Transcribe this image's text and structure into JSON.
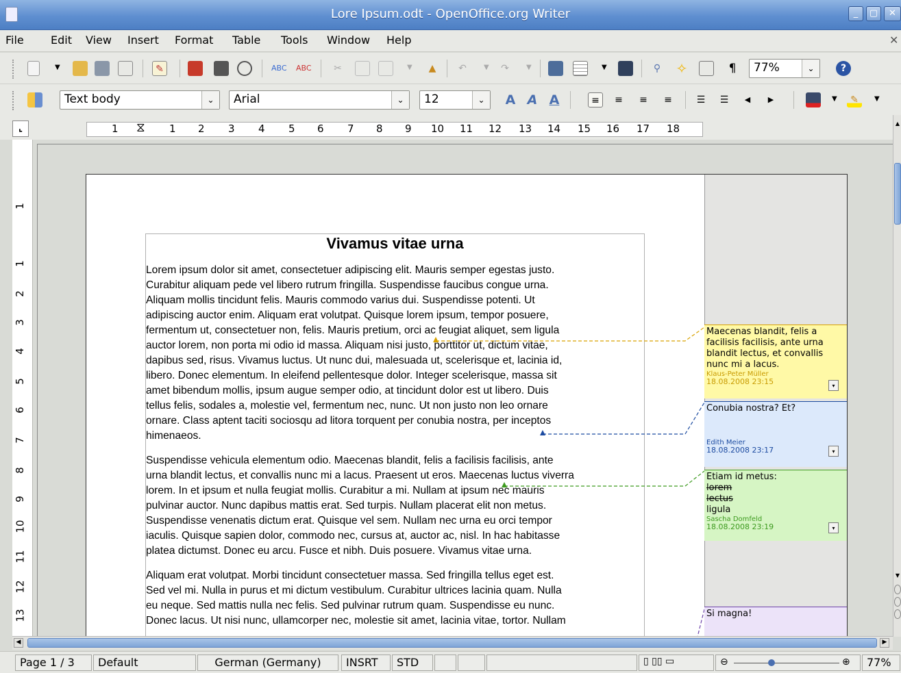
{
  "window": {
    "title": "Lore Ipsum.odt - OpenOffice.org Writer",
    "min": "_",
    "max": "▢",
    "close": "✕"
  },
  "menu": [
    "File",
    "Edit",
    "View",
    "Insert",
    "Format",
    "Table",
    "Tools",
    "Window",
    "Help"
  ],
  "menu_close": "✕",
  "toolbar": {
    "zoom": "77%"
  },
  "format": {
    "style": "Text body",
    "font": "Arial",
    "size": "12"
  },
  "ruler": {
    "ticks": [
      "1",
      "1",
      "2",
      "3",
      "4",
      "5",
      "6",
      "7",
      "8",
      "9",
      "10",
      "11",
      "12",
      "13",
      "14",
      "15",
      "16",
      "17",
      "18"
    ]
  },
  "vruler": [
    "1",
    "1",
    "2",
    "3",
    "4",
    "5",
    "6",
    "7",
    "8",
    "9",
    "10",
    "11",
    "12",
    "13"
  ],
  "doc": {
    "title": "Vivamus vitae urna",
    "p1": [
      "Lorem ipsum dolor sit amet, consectetuer adipiscing elit. Mauris semper egestas justo.",
      "Curabitur aliquam pede vel libero rutrum fringilla. Suspendisse faucibus congue urna.",
      "Aliquam mollis tincidunt felis. Mauris commodo varius dui. Suspendisse potenti. Ut",
      "adipiscing auctor enim. Aliquam erat volutpat. Quisque lorem ipsum, tempor posuere,",
      "fermentum ut, consectetuer non, felis. Mauris pretium, orci ac feugiat aliquet, sem ligula",
      "auctor lorem, non porta mi odio id massa. Aliquam nisi justo, porttitor ut, dictum vitae,",
      "dapibus sed, risus. Vivamus luctus. Ut nunc dui, malesuada ut, scelerisque et, lacinia id,",
      "libero. Donec elementum. In eleifend pellentesque dolor. Integer scelerisque, massa sit",
      "amet bibendum mollis, ipsum augue semper odio, at tincidunt dolor est ut libero. Duis",
      "tellus felis, sodales a, molestie vel, fermentum nec, nunc. Ut non justo non leo ornare",
      "ornare. Class aptent taciti sociosqu ad litora torquent per conubia nostra, per inceptos",
      "himenaeos."
    ],
    "p2": [
      "Suspendisse vehicula elementum odio. Maecenas blandit, felis a facilisis facilisis, ante",
      "urna blandit lectus, et convallis nunc mi a lacus. Praesent ut eros. Maecenas luctus viverra",
      "lorem. In et ipsum et nulla feugiat mollis. Curabitur a mi. Nullam at ipsum nec mauris",
      "pulvinar auctor. Nunc dapibus mattis erat. Sed turpis. Nullam placerat elit non metus.",
      "Suspendisse venenatis dictum erat. Quisque vel sem. Nullam nec urna eu orci tempor",
      "iaculis. Quisque sapien dolor, commodo nec, cursus at, auctor ac, nisl. In hac habitasse",
      "platea dictumst. Donec eu arcu. Fusce et nibh. Duis posuere. Vivamus vitae urna."
    ],
    "p3": [
      "Aliquam erat volutpat. Morbi tincidunt consectetuer massa. Sed fringilla tellus eget est.",
      "Sed vel mi. Nulla in purus et mi dictum vestibulum. Curabitur ultrices lacinia quam. Nulla",
      "eu neque. Sed mattis nulla nec felis. Sed pulvinar rutrum quam. Suspendisse eu nunc.",
      "Donec lacus. Ut nisi nunc, ullamcorper nec, molestie sit amet, lacinia vitae, tortor. Nullam"
    ]
  },
  "notes": [
    {
      "text": [
        "Maecenas blandit, felis a",
        "facilisis facilisis, ante urna",
        "blandit lectus, et convallis",
        "nunc mi a lacus."
      ],
      "author": "Klaus-Peter Müller",
      "date": "18.08.2008 23:15",
      "bg": "#fff9a6",
      "color": "#c89a00"
    },
    {
      "text": [
        "Conubia nostra? Et?"
      ],
      "author": "Edith Meier",
      "date": "18.08.2008 23:17",
      "bg": "#dce9fb",
      "color": "#1b4aa0"
    },
    {
      "text": [
        "Etiam id metus:"
      ],
      "struck": [
        "lorem",
        "lectus"
      ],
      "extra": "ligula",
      "author": "Sascha Domfeld",
      "date": "18.08.2008 23:19",
      "bg": "#d6f5c4",
      "color": "#3c9a1e"
    },
    {
      "text": [
        "Si magna!"
      ],
      "bg": "#ece3f9",
      "color": "#6a3fa8"
    }
  ],
  "status": {
    "page": "Page 1 / 3",
    "style": "Default",
    "lang": "German (Germany)",
    "insert": "INSRT",
    "sel": "STD",
    "zoom": "77%"
  }
}
